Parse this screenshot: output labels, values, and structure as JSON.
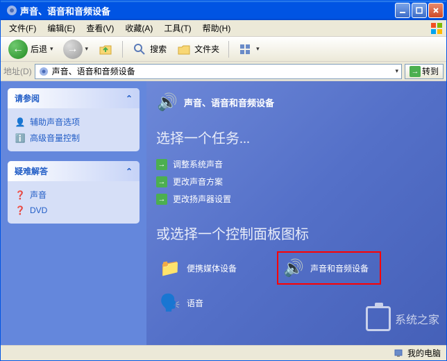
{
  "titlebar": {
    "text": "声音、语音和音频设备"
  },
  "menubar": {
    "file": "文件(F)",
    "edit": "编辑(E)",
    "view": "查看(V)",
    "favorites": "收藏(A)",
    "tools": "工具(T)",
    "help": "帮助(H)"
  },
  "toolbar": {
    "back": "后退",
    "search": "搜索",
    "folders": "文件夹"
  },
  "addressbar": {
    "label": "地址(D)",
    "path": "声音、语音和音频设备",
    "go": "转到"
  },
  "sidebar": {
    "see_also": {
      "title": "请参阅",
      "items": [
        "辅助声音选项",
        "高级音量控制"
      ]
    },
    "troubleshoot": {
      "title": "疑难解答",
      "items": [
        "声音",
        "DVD"
      ]
    }
  },
  "main": {
    "category_title": "声音、语音和音频设备",
    "pick_task": "选择一个任务...",
    "tasks": [
      "调整系统声音",
      "更改声音方案",
      "更改扬声器设置"
    ],
    "pick_icon": "或选择一个控制面板图标",
    "icons": [
      {
        "label": "便携媒体设备"
      },
      {
        "label": "声音和音频设备"
      },
      {
        "label": "语音"
      }
    ]
  },
  "statusbar": {
    "text": "我的电脑"
  },
  "watermark": "系统之家"
}
